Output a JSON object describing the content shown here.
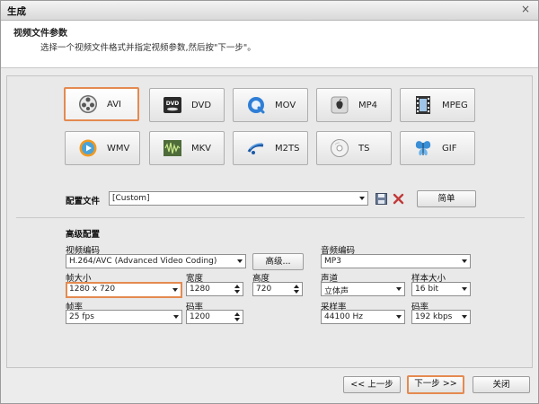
{
  "window": {
    "title": "生成",
    "close_glyph": "×"
  },
  "header": {
    "title": "视频文件参数",
    "subtitle": "选择一个视频文件格式并指定视频参数,然后按\"下一步\"。"
  },
  "formats": {
    "row1": [
      {
        "label": "AVI",
        "icon": "film-reel-icon",
        "selected": true
      },
      {
        "label": "DVD",
        "icon": "dvd-icon"
      },
      {
        "label": "MOV",
        "icon": "quicktime-icon"
      },
      {
        "label": "MP4",
        "icon": "apple-icon"
      },
      {
        "label": "MPEG",
        "icon": "film-strip-icon"
      }
    ],
    "row2": [
      {
        "label": "WMV",
        "icon": "media-player-icon"
      },
      {
        "label": "MKV",
        "icon": "waveform-icon"
      },
      {
        "label": "M2TS",
        "icon": "bluray-icon"
      },
      {
        "label": "TS",
        "icon": "disc-icon"
      },
      {
        "label": "GIF",
        "icon": "butterfly-icon"
      }
    ]
  },
  "profile": {
    "label": "配置文件",
    "value": "[Custom]",
    "simple_button": "简单",
    "save_icon": "save-icon",
    "delete_icon": "delete-icon"
  },
  "advanced": {
    "label": "高级配置",
    "video_codec": {
      "label": "视频编码",
      "value": "H.264/AVC (Advanced Video Coding)",
      "button": "高级..."
    },
    "audio_codec": {
      "label": "音频编码",
      "value": "MP3"
    },
    "frame_size": {
      "label": "帧大小",
      "value": "1280 x 720"
    },
    "width": {
      "label": "宽度",
      "value": "1280"
    },
    "height": {
      "label": "高度",
      "value": "720"
    },
    "channels": {
      "label": "声道",
      "value": "立体声"
    },
    "sample_size": {
      "label": "样本大小",
      "value": "16 bit"
    },
    "frame_rate": {
      "label": "帧率",
      "value": "25 fps"
    },
    "video_bitrate": {
      "label": "码率",
      "value": "1200"
    },
    "sample_rate": {
      "label": "采样率",
      "value": "44100 Hz"
    },
    "audio_bitrate": {
      "label": "码率",
      "value": "192 kbps"
    }
  },
  "footer": {
    "prev": "<< 上一步",
    "next": "下一步 >>",
    "close": "关闭"
  },
  "colors": {
    "accent": "#e48a50"
  }
}
